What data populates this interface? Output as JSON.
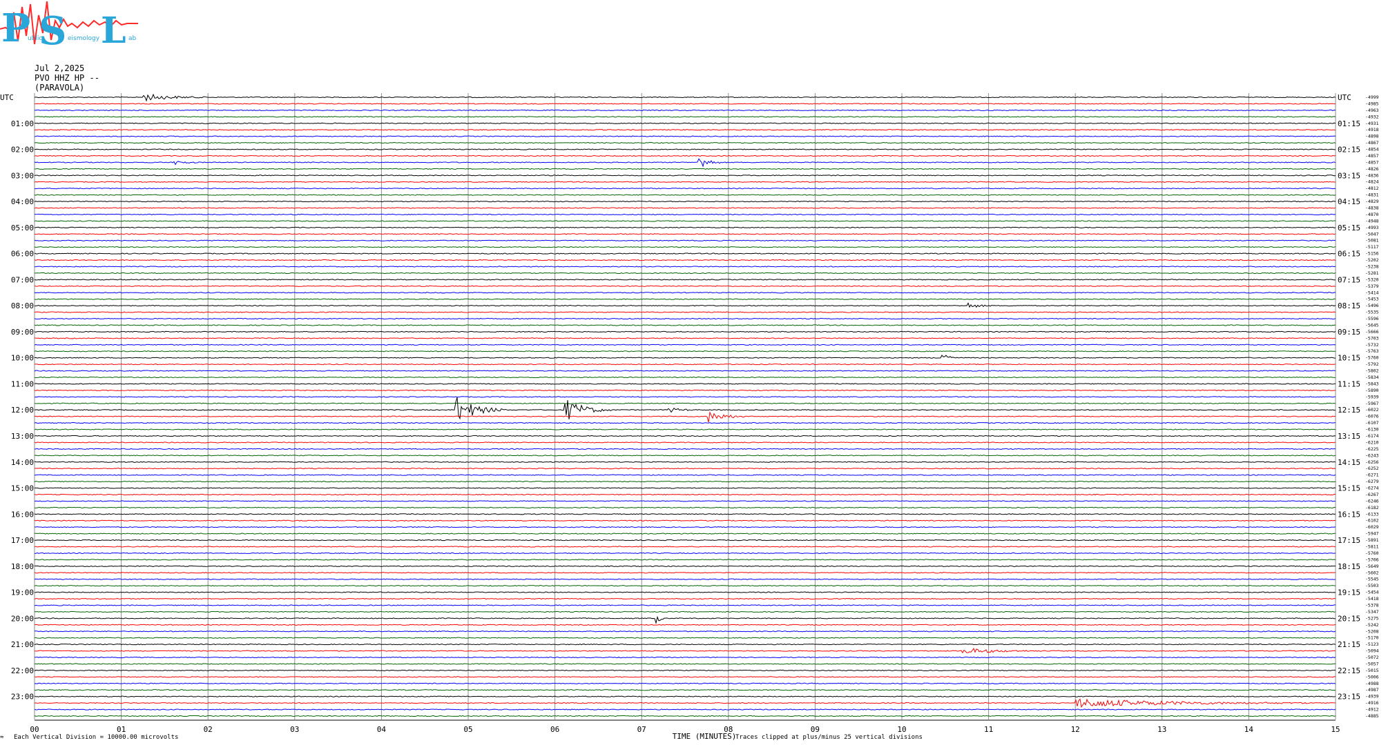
{
  "header": {
    "logo_letters": [
      "P",
      "S",
      "L"
    ],
    "logo_small_words": [
      "ublic",
      "eismology",
      "ab"
    ],
    "date": "Jul 2,2025",
    "channel": "PVO HHZ HP --",
    "station_name": "(PARAVOLA)"
  },
  "chart_data": {
    "type": "line",
    "title": "",
    "left_axis_title": "UTC",
    "right_axis_title": "UTC",
    "xlabel": "TIME (MINUTES)",
    "x_ticks": [
      "00",
      "01",
      "02",
      "03",
      "04",
      "05",
      "06",
      "07",
      "08",
      "09",
      "10",
      "11",
      "12",
      "13",
      "14",
      "15"
    ],
    "xlim": [
      0,
      15
    ],
    "traces_count": 96,
    "trace_interval_minutes": 15,
    "color_cycle": [
      "#000000",
      "#ff0000",
      "#0000ff",
      "#006400"
    ],
    "grid_color": "#8c8c8c",
    "left_hour_labels": [
      "UTC",
      "01:00",
      "02:00",
      "03:00",
      "04:00",
      "05:00",
      "06:00",
      "07:00",
      "08:00",
      "09:00",
      "10:00",
      "11:00",
      "12:00",
      "13:00",
      "14:00",
      "15:00",
      "16:00",
      "17:00",
      "18:00",
      "19:00",
      "20:00",
      "21:00",
      "22:00",
      "23:00"
    ],
    "right_hour_labels": [
      "UTC",
      "01:15",
      "02:15",
      "03:15",
      "04:15",
      "05:15",
      "06:15",
      "07:15",
      "08:15",
      "09:15",
      "10:15",
      "11:15",
      "12:15",
      "13:15",
      "14:15",
      "15:15",
      "16:15",
      "17:15",
      "18:15",
      "19:15",
      "20:15",
      "21:15",
      "22:15",
      "23:15"
    ],
    "trace_offsets": [
      -4999,
      -4985,
      -4963,
      -4932,
      -4931,
      -4918,
      -4898,
      -4867,
      -4854,
      -4857,
      -4857,
      -4826,
      -4836,
      -4824,
      -4812,
      -4831,
      -4829,
      -4838,
      -4870,
      -4948,
      -4993,
      -5047,
      -5081,
      -5117,
      -5156,
      -5202,
      -5238,
      -5281,
      -5320,
      -5379,
      -5414,
      -5453,
      -5496,
      -5535,
      -5596,
      -5645,
      -5666,
      -5703,
      -5732,
      -5763,
      -5760,
      -5792,
      -5802,
      -5834,
      -5843,
      -5890,
      -5939,
      -5967,
      -6022,
      -6076,
      -6107,
      -6130,
      -6174,
      -6210,
      -6225,
      -6243,
      -6256,
      -6252,
      -6271,
      -6279,
      -6274,
      -6267,
      -6246,
      -6182,
      -6133,
      -6102,
      -6029,
      -5947,
      -5891,
      -5811,
      -5760,
      -5706,
      -5649,
      -5602,
      -5545,
      -5503,
      -5454,
      -5418,
      -5378,
      -5347,
      -5275,
      -5242,
      -5208,
      -5170,
      -5123,
      -5094,
      -5072,
      -5057,
      -5015,
      -5006,
      -4988,
      -4987,
      -4939,
      -4916,
      -4912,
      -4885
    ],
    "events": [
      {
        "trace": 0,
        "start_min": 1.25,
        "duration_min": 0.75,
        "amplitude": 0.6
      },
      {
        "trace": 10,
        "start_min": 7.65,
        "duration_min": 0.25,
        "amplitude": 1.6
      },
      {
        "trace": 10,
        "start_min": 1.6,
        "duration_min": 0.3,
        "amplitude": 0.4
      },
      {
        "trace": 32,
        "start_min": 10.75,
        "duration_min": 0.3,
        "amplitude": 0.5
      },
      {
        "trace": 40,
        "start_min": 10.45,
        "duration_min": 0.15,
        "amplitude": 2.5
      },
      {
        "trace": 48,
        "start_min": 4.85,
        "duration_min": 0.6,
        "amplitude": 2.2
      },
      {
        "trace": 48,
        "start_min": 6.1,
        "duration_min": 0.55,
        "amplitude": 2.0
      },
      {
        "trace": 49,
        "start_min": 7.75,
        "duration_min": 0.5,
        "amplitude": 1.0
      },
      {
        "trace": 48,
        "start_min": 7.3,
        "duration_min": 0.35,
        "amplitude": 0.4
      },
      {
        "trace": 80,
        "start_min": 7.15,
        "duration_min": 0.1,
        "amplitude": 1.6
      },
      {
        "trace": 85,
        "start_min": 10.7,
        "duration_min": 0.9,
        "amplitude": 0.5
      },
      {
        "trace": 93,
        "start_min": 12.0,
        "duration_min": 2.7,
        "amplitude": 0.7
      }
    ]
  },
  "footer": {
    "left_note": "Each Vertical Division = 10000.00 microvolts",
    "right_note": "Traces clipped at plus/minus 25 vertical divisions",
    "corner_mark": "≈"
  }
}
